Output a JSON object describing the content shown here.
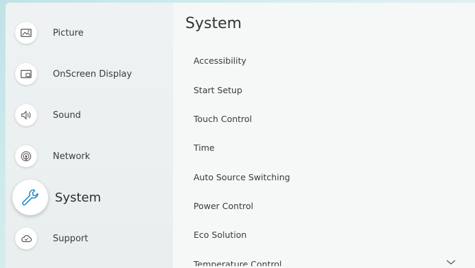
{
  "sidebar": {
    "items": [
      {
        "label": "Picture",
        "icon": "picture-icon"
      },
      {
        "label": "OnScreen Display",
        "icon": "onscreen-display-icon"
      },
      {
        "label": "Sound",
        "icon": "sound-icon"
      },
      {
        "label": "Network",
        "icon": "network-icon"
      },
      {
        "label": "System",
        "icon": "wrench-icon",
        "active": true
      },
      {
        "label": "Support",
        "icon": "cloud-support-icon"
      }
    ]
  },
  "main": {
    "title": "System",
    "items": [
      "Accessibility",
      "Start Setup",
      "Touch Control",
      "Time",
      "Auto Source Switching",
      "Power Control",
      "Eco Solution",
      "Temperature Control"
    ]
  }
}
